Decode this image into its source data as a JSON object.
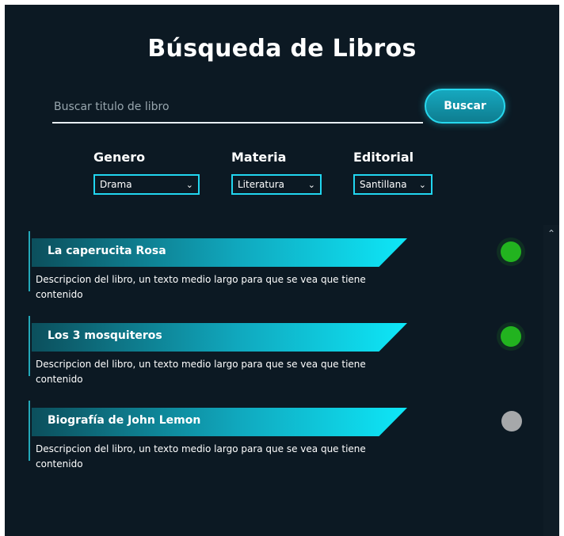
{
  "page": {
    "title": "Búsqueda de Libros"
  },
  "search": {
    "placeholder": "Buscar titulo de libro",
    "value": "",
    "button_label": "Buscar"
  },
  "filters": [
    {
      "label": "Genero",
      "selected": "Drama"
    },
    {
      "label": "Materia",
      "selected": "Literatura"
    },
    {
      "label": "Editorial",
      "selected": "Santillana"
    }
  ],
  "books": [
    {
      "title": "La caperucita Rosa",
      "description": "Descripcion del libro, un texto medio largo para que se vea que tiene contenido",
      "status": "available"
    },
    {
      "title": "Los 3 mosquiteros",
      "description": "Descripcion del libro, un texto medio largo para que se vea que tiene contenido",
      "status": "available"
    },
    {
      "title": "Biografía de John Lemon",
      "description": "Descripcion del libro, un texto medio largo para que se vea que tiene contenido",
      "status": "unavailable"
    }
  ],
  "colors": {
    "background": "#0c1923",
    "accent": "#21d6f0",
    "status_active": "#22b31f",
    "status_inactive": "#a6a8aa"
  },
  "icons": {
    "dropdown": "chevron-down-icon",
    "scroll_up": "chevron-up-icon"
  }
}
